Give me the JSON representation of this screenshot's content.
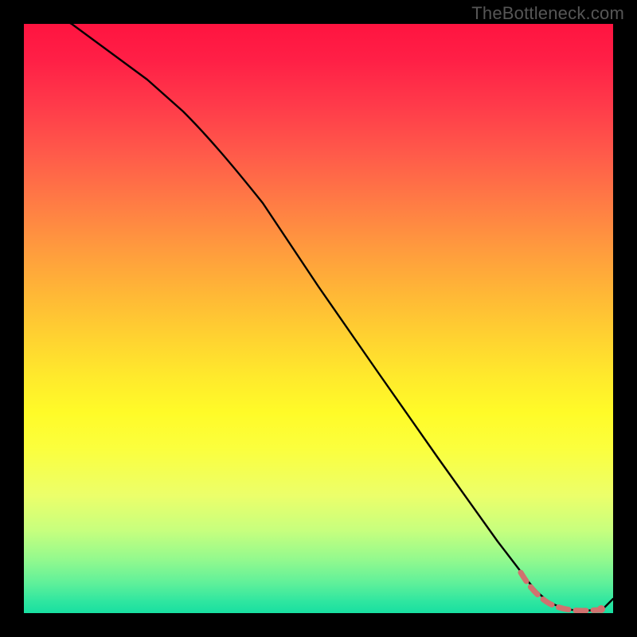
{
  "watermark": "TheBottleneck.com",
  "chart_data": {
    "type": "line",
    "title": "",
    "xlabel": "",
    "ylabel": "",
    "xlim": [
      0,
      100
    ],
    "ylim": [
      0,
      100
    ],
    "series": [
      {
        "name": "curve",
        "x": [
          0,
          8,
          14,
          20,
          26,
          32,
          40,
          50,
          60,
          70,
          80,
          85,
          88,
          90,
          92,
          94,
          96,
          98,
          100
        ],
        "values": [
          104,
          100,
          96,
          91,
          86,
          80,
          70,
          56,
          42,
          28,
          14,
          7,
          3,
          1.2,
          0.6,
          0.4,
          0.5,
          1.2,
          2.4
        ]
      }
    ],
    "highlight_range": {
      "x_start": 84,
      "x_end": 98,
      "style": "dashed-salmon"
    }
  },
  "colors": {
    "curve": "#000000",
    "highlight": "#d0726f",
    "background_top": "#ff1440",
    "background_bottom": "#18dfa1",
    "frame": "#000000"
  }
}
